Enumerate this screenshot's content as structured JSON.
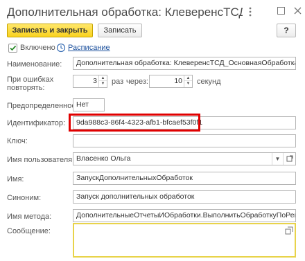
{
  "window": {
    "title": "Дополнительная обработка: КлеверенсТСД_Ос…",
    "menu_icon": "more-vert-icon",
    "maximize_icon": "maximize-icon",
    "close_icon": "close-icon"
  },
  "toolbar": {
    "save_close_label": "Записать и закрыть",
    "save_label": "Записать",
    "help_label": "?"
  },
  "enabled": {
    "checked": true,
    "label": "Включено",
    "schedule_link": "Расписание",
    "schedule_icon": "clock-icon"
  },
  "fields": {
    "name": {
      "label": "Наименование:",
      "value": "Дополнительная обработка: КлеверенсТСД_ОсновнаяОбработка / Н"
    },
    "retry": {
      "label_line1": "При ошибках",
      "label_line2": "повторять:",
      "count": "3",
      "times_text": "раз",
      "after_text": "через:",
      "interval": "10",
      "seconds_text": "секунд"
    },
    "predefined": {
      "label": "Предопределенное:",
      "value": "Нет"
    },
    "identifier": {
      "label": "Идентификатор:",
      "value": "9da988c3-86f4-4323-afb1-bfcaef53f0f1"
    },
    "key": {
      "label": "Ключ:",
      "value": ""
    },
    "user": {
      "label": "Имя пользователя:",
      "value": "Власенко Ольга"
    },
    "job_name": {
      "label": "Имя:",
      "value": "ЗапускДополнительныхОбработок"
    },
    "synonym": {
      "label": "Синоним:",
      "value": "Запуск дополнительных обработок"
    },
    "method": {
      "label": "Имя метода:",
      "value": "ДополнительныеОтчетыИОбработки.ВыполнитьОбработкуПоРегла"
    },
    "message": {
      "label": "Сообщение:",
      "value": ""
    }
  },
  "colors": {
    "primary_button": "#f9d21f",
    "highlight_border": "#e00000",
    "link": "#1a4f9c",
    "message_border": "#e8d34a"
  }
}
